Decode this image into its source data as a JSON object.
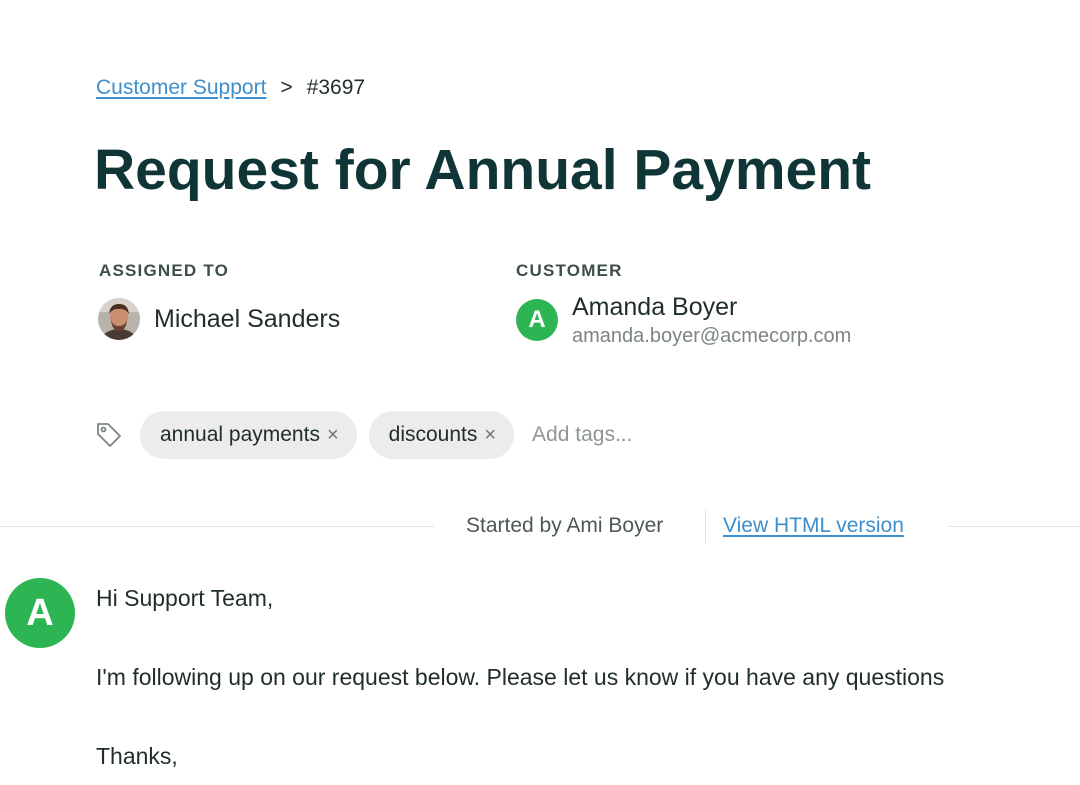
{
  "breadcrumb": {
    "parent": "Customer Support",
    "separator": ">",
    "current": "#3697"
  },
  "ticket": {
    "title": "Request for Annual Payment"
  },
  "assigned": {
    "label": "ASSIGNED TO",
    "name": "Michael Sanders"
  },
  "customer": {
    "label": "CUSTOMER",
    "initial": "A",
    "name": "Amanda Boyer",
    "email": "amanda.boyer@acmecorp.com",
    "avatar_color": "#2eb553"
  },
  "tags": {
    "items": [
      {
        "label": "annual payments",
        "remove": "×"
      },
      {
        "label": "discounts",
        "remove": "×"
      }
    ],
    "placeholder": "Add tags..."
  },
  "thread": {
    "started_by": "Started by Ami Boyer",
    "view_html": "View HTML version"
  },
  "message": {
    "avatar_initial": "A",
    "greeting": "Hi Support Team,",
    "body": "I'm following up on our request below. Please let us know if you have any questions",
    "closing": "Thanks,"
  },
  "colors": {
    "link": "#3d8fce",
    "title": "#0f3536",
    "tag_background": "#ececec"
  }
}
